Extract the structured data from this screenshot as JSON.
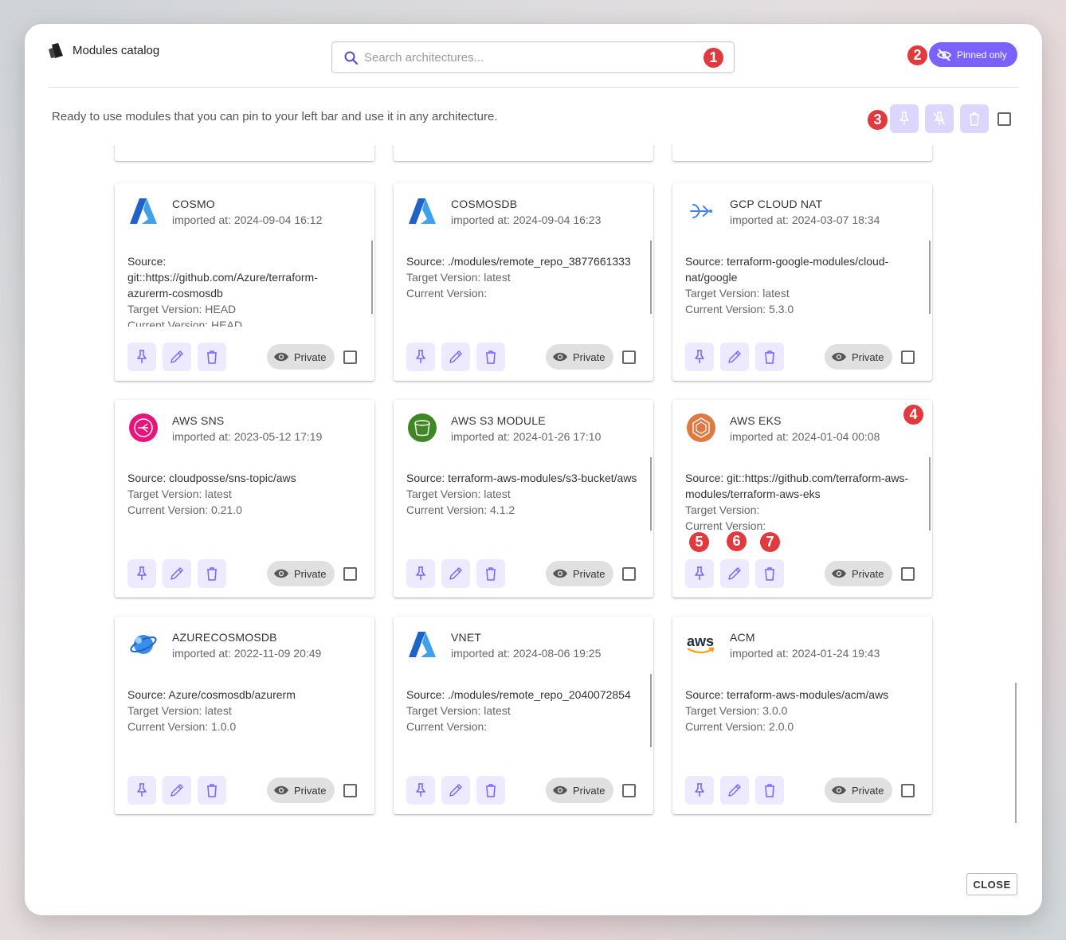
{
  "header": {
    "title": "Modules catalog",
    "search_placeholder": "Search architectures...",
    "pinned_label": "Pinned only",
    "subtitle": "Ready to use modules that you can pin to your left bar and use it in any architecture."
  },
  "annotations": [
    "1",
    "2",
    "3",
    "4",
    "5",
    "6",
    "7"
  ],
  "colors": {
    "accent": "#7b61ff",
    "action_bg": "#ede9ff",
    "badge": "#e03a3e"
  },
  "modules": [
    {
      "name": "COSMO",
      "date": "imported at: 2024-09-04 16:12",
      "icon": "azure-icon",
      "source": "Source: git::https://github.com/Azure/terraform-azurerm-cosmosdb",
      "target": "Target Version: HEAD",
      "current": "Current Version: HEAD",
      "visibility": "Private"
    },
    {
      "name": "COSMOSDB",
      "date": "imported at: 2024-09-04 16:23",
      "icon": "azure-icon",
      "source": "Source: ./modules/remote_repo_3877661333",
      "target": "Target Version: latest",
      "current": "Current Version:",
      "visibility": "Private"
    },
    {
      "name": "GCP CLOUD NAT",
      "date": "imported at: 2024-03-07 18:34",
      "icon": "gcp-cloud-nat-icon",
      "source": "Source: terraform-google-modules/cloud-nat/google",
      "target": "Target Version: latest",
      "current": "Current Version: 5.3.0",
      "visibility": "Private"
    },
    {
      "name": "AWS SNS",
      "date": "imported at: 2023-05-12 17:19",
      "icon": "aws-sns-icon",
      "source": "Source: cloudposse/sns-topic/aws",
      "target": "Target Version: latest",
      "current": "Current Version: 0.21.0",
      "visibility": "Private"
    },
    {
      "name": "AWS S3 MODULE",
      "date": "imported at: 2024-01-26 17:10",
      "icon": "aws-s3-icon",
      "source": "Source: terraform-aws-modules/s3-bucket/aws",
      "target": "Target Version: latest",
      "current": "Current Version: 4.1.2",
      "visibility": "Private"
    },
    {
      "name": "AWS EKS",
      "date": "imported at: 2024-01-04 00:08",
      "icon": "aws-eks-icon",
      "source": "Source: git::https://github.com/terraform-aws-modules/terraform-aws-eks",
      "target": "Target Version:",
      "current": "Current Version:",
      "visibility": "Private"
    },
    {
      "name": "AZURECOSMOSDB",
      "date": "imported at: 2022-11-09 20:49",
      "icon": "azure-cosmosdb-icon",
      "source": "Source: Azure/cosmosdb/azurerm",
      "target": "Target Version: latest",
      "current": "Current Version: 1.0.0",
      "visibility": "Private"
    },
    {
      "name": "VNET",
      "date": "imported at: 2024-08-06 19:25",
      "icon": "azure-icon",
      "source": "Source: ./modules/remote_repo_2040072854",
      "target": "Target Version: latest",
      "current": "Current Version:",
      "visibility": "Private"
    },
    {
      "name": "ACM",
      "date": "imported at: 2024-01-24 19:43",
      "icon": "aws-logo-icon",
      "source": "Source: terraform-aws-modules/acm/aws",
      "target": "Target Version: 3.0.0",
      "current": "Current Version: 2.0.0",
      "visibility": "Private"
    }
  ],
  "footer": {
    "close_label": "CLOSE"
  }
}
